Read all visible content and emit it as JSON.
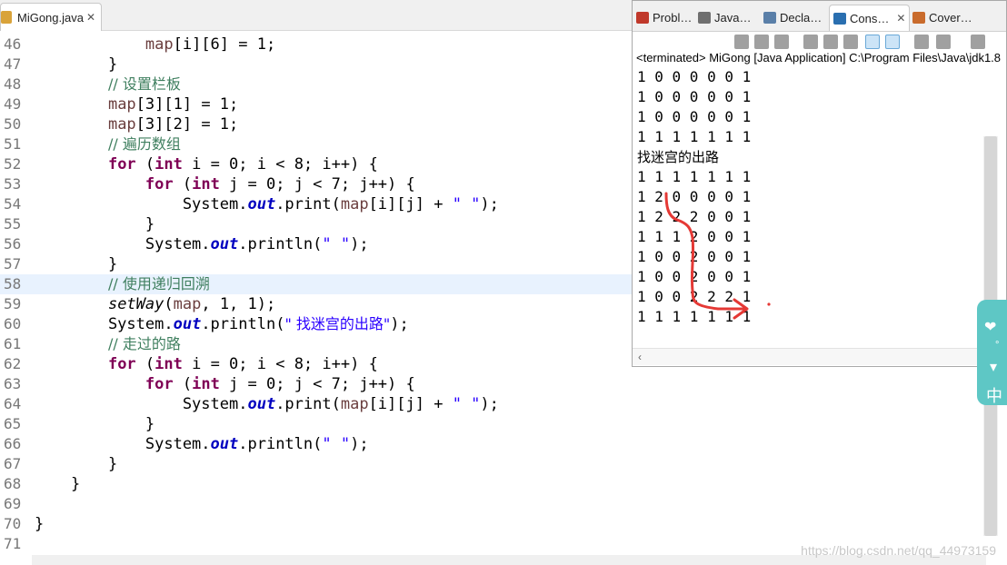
{
  "editor": {
    "tab_label": "MiGong.java",
    "close_glyph": "✕",
    "lines": [
      {
        "no": "46",
        "segments": [
          {
            "t": "        ",
            "c": ""
          },
          {
            "t": "map",
            "c": "var"
          },
          {
            "t": "[i][6] = 1;",
            "c": ""
          }
        ]
      },
      {
        "no": "47",
        "segments": [
          {
            "t": "    }",
            "c": ""
          }
        ]
      },
      {
        "no": "48",
        "segments": [
          {
            "t": "    ",
            "c": ""
          },
          {
            "t": "// 设置栏板",
            "c": "cm"
          }
        ]
      },
      {
        "no": "49",
        "segments": [
          {
            "t": "    ",
            "c": ""
          },
          {
            "t": "map",
            "c": "var"
          },
          {
            "t": "[3][1] = 1;",
            "c": ""
          }
        ]
      },
      {
        "no": "50",
        "segments": [
          {
            "t": "    ",
            "c": ""
          },
          {
            "t": "map",
            "c": "var"
          },
          {
            "t": "[3][2] = 1;",
            "c": ""
          }
        ]
      },
      {
        "no": "51",
        "segments": [
          {
            "t": "    ",
            "c": ""
          },
          {
            "t": "// 遍历数组",
            "c": "cm"
          }
        ]
      },
      {
        "no": "52",
        "segments": [
          {
            "t": "    ",
            "c": ""
          },
          {
            "t": "for",
            "c": "kw"
          },
          {
            "t": " (",
            "c": ""
          },
          {
            "t": "int",
            "c": "kw"
          },
          {
            "t": " i = 0; i < 8; i++) {",
            "c": ""
          }
        ]
      },
      {
        "no": "53",
        "segments": [
          {
            "t": "        ",
            "c": ""
          },
          {
            "t": "for",
            "c": "kw"
          },
          {
            "t": " (",
            "c": ""
          },
          {
            "t": "int",
            "c": "kw"
          },
          {
            "t": " j = 0; j < 7; j++) {",
            "c": ""
          }
        ]
      },
      {
        "no": "54",
        "segments": [
          {
            "t": "            System.",
            "c": ""
          },
          {
            "t": "out",
            "c": "fld"
          },
          {
            "t": ".print(",
            "c": ""
          },
          {
            "t": "map",
            "c": "var"
          },
          {
            "t": "[i][j] + ",
            "c": ""
          },
          {
            "t": "\" \"",
            "c": "str"
          },
          {
            "t": ");",
            "c": ""
          }
        ]
      },
      {
        "no": "55",
        "segments": [
          {
            "t": "        }",
            "c": ""
          }
        ]
      },
      {
        "no": "56",
        "segments": [
          {
            "t": "        System.",
            "c": ""
          },
          {
            "t": "out",
            "c": "fld"
          },
          {
            "t": ".println(",
            "c": ""
          },
          {
            "t": "\" \"",
            "c": "str"
          },
          {
            "t": ");",
            "c": ""
          }
        ]
      },
      {
        "no": "57",
        "segments": [
          {
            "t": "    }",
            "c": ""
          }
        ]
      },
      {
        "no": "58",
        "current": true,
        "segments": [
          {
            "t": "    ",
            "c": ""
          },
          {
            "t": "// 使用递归回溯",
            "c": "cm"
          }
        ]
      },
      {
        "no": "59",
        "segments": [
          {
            "t": "    ",
            "c": ""
          },
          {
            "t": "setWay",
            "c": "mth"
          },
          {
            "t": "(",
            "c": ""
          },
          {
            "t": "map",
            "c": "var"
          },
          {
            "t": ", 1, 1);",
            "c": ""
          }
        ]
      },
      {
        "no": "60",
        "segments": [
          {
            "t": "    System.",
            "c": ""
          },
          {
            "t": "out",
            "c": "fld"
          },
          {
            "t": ".println(",
            "c": ""
          },
          {
            "t": "\" 找迷宫的出路\"",
            "c": "str"
          },
          {
            "t": ");",
            "c": ""
          }
        ]
      },
      {
        "no": "61",
        "segments": [
          {
            "t": "    ",
            "c": ""
          },
          {
            "t": "// 走过的路",
            "c": "cm"
          }
        ]
      },
      {
        "no": "62",
        "segments": [
          {
            "t": "    ",
            "c": ""
          },
          {
            "t": "for",
            "c": "kw"
          },
          {
            "t": " (",
            "c": ""
          },
          {
            "t": "int",
            "c": "kw"
          },
          {
            "t": " i = 0; i < 8; i++) {",
            "c": ""
          }
        ]
      },
      {
        "no": "63",
        "segments": [
          {
            "t": "        ",
            "c": ""
          },
          {
            "t": "for",
            "c": "kw"
          },
          {
            "t": " (",
            "c": ""
          },
          {
            "t": "int",
            "c": "kw"
          },
          {
            "t": " j = 0; j < 7; j++) {",
            "c": ""
          }
        ]
      },
      {
        "no": "64",
        "segments": [
          {
            "t": "            System.",
            "c": ""
          },
          {
            "t": "out",
            "c": "fld"
          },
          {
            "t": ".print(",
            "c": ""
          },
          {
            "t": "map",
            "c": "var"
          },
          {
            "t": "[i][j] + ",
            "c": ""
          },
          {
            "t": "\" \"",
            "c": "str"
          },
          {
            "t": ");",
            "c": ""
          }
        ]
      },
      {
        "no": "65",
        "segments": [
          {
            "t": "        }",
            "c": ""
          }
        ]
      },
      {
        "no": "66",
        "segments": [
          {
            "t": "        System.",
            "c": ""
          },
          {
            "t": "out",
            "c": "fld"
          },
          {
            "t": ".println(",
            "c": ""
          },
          {
            "t": "\" \"",
            "c": "str"
          },
          {
            "t": ");",
            "c": ""
          }
        ]
      },
      {
        "no": "67",
        "segments": [
          {
            "t": "    }",
            "c": ""
          }
        ]
      },
      {
        "no": "68",
        "segments": [
          {
            "t": "}",
            "c": ""
          }
        ]
      },
      {
        "no": "69",
        "segments": []
      },
      {
        "no": "70",
        "segments": [
          {
            "t": "}",
            "c": "",
            "outdent": true
          }
        ]
      },
      {
        "no": "71",
        "segments": []
      }
    ]
  },
  "console": {
    "tabs": [
      {
        "label": "Probl…",
        "icon_color": "#c0392b"
      },
      {
        "label": "Java…",
        "icon_color": "#6f6f6f"
      },
      {
        "label": "Decla…",
        "icon_color": "#5a7fa8"
      },
      {
        "label": "Cons…",
        "icon_color": "#2a6fb0",
        "active": true
      },
      {
        "label": "Cover…",
        "icon_color": "#c96b2c"
      }
    ],
    "terminated_text": "<terminated> MiGong [Java Application] C:\\Program Files\\Java\\jdk1.8",
    "output_lines": [
      "1 0 0 0 0 0 1",
      "1 0 0 0 0 0 1",
      "1 0 0 0 0 0 1",
      "1 1 1 1 1 1 1",
      "找迷宫的出路",
      "1 1 1 1 1 1 1",
      "1 2 0 0 0 0 1",
      "1 2 2 2 0 0 1",
      "1 1 1 2 0 0 1",
      "1 0 0 2 0 0 1",
      "1 0 0 2 0 0 1",
      "1 0 0 2 2 2 1",
      "1 1 1 1 1 1 1"
    ],
    "annotation_color": "#e53935"
  },
  "overlay": {
    "watermark": "https://blog.csdn.net/qq_44973159",
    "ime_char": "中"
  }
}
